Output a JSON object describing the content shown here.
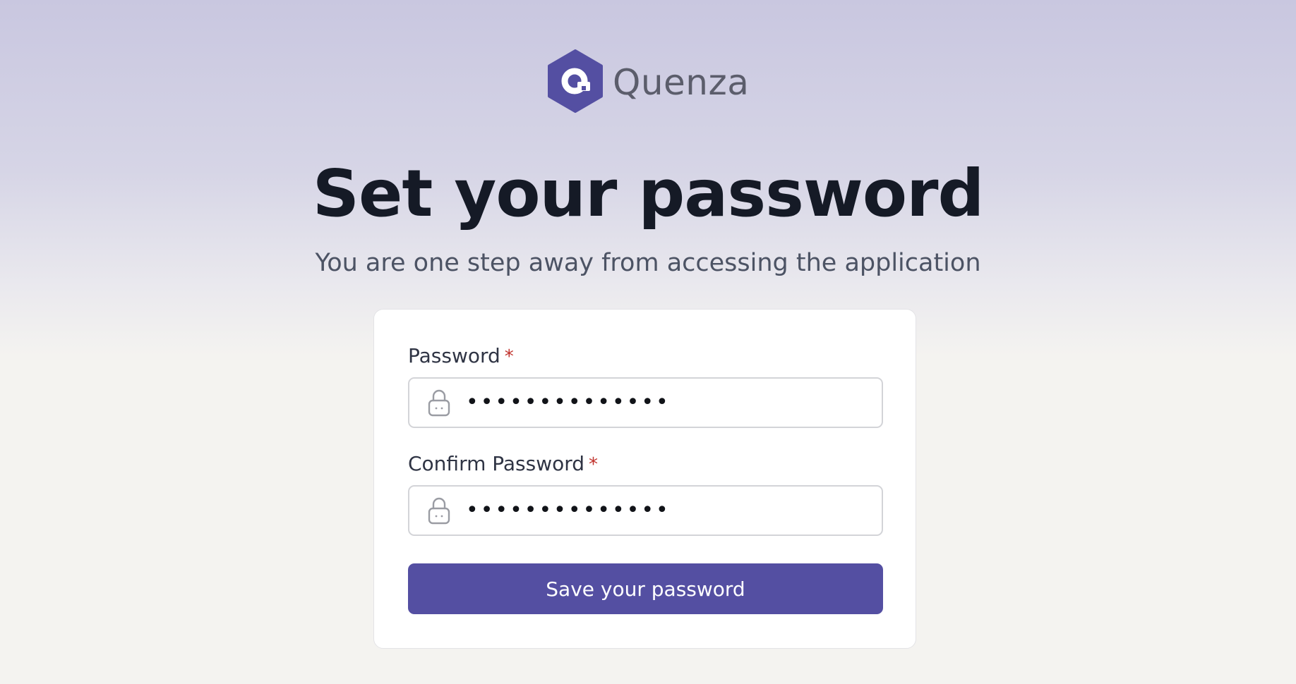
{
  "brand": {
    "name": "Quenza",
    "logo_icon": "quenza-hexagon-logo",
    "logo_color": "#544fa2"
  },
  "page": {
    "title": "Set your password",
    "subtitle": "You are one step away from accessing the application"
  },
  "form": {
    "password": {
      "label": "Password",
      "required_marker": "*",
      "value_masked": "••••••••••••••",
      "icon": "lock-icon"
    },
    "confirm_password": {
      "label": "Confirm Password",
      "required_marker": "*",
      "value_masked": "••••••••••••••",
      "icon": "lock-icon"
    },
    "submit_label": "Save your password"
  },
  "colors": {
    "accent": "#544fa2",
    "required": "#c0312b",
    "heading": "#151a26",
    "subtitle": "#4c5364"
  }
}
